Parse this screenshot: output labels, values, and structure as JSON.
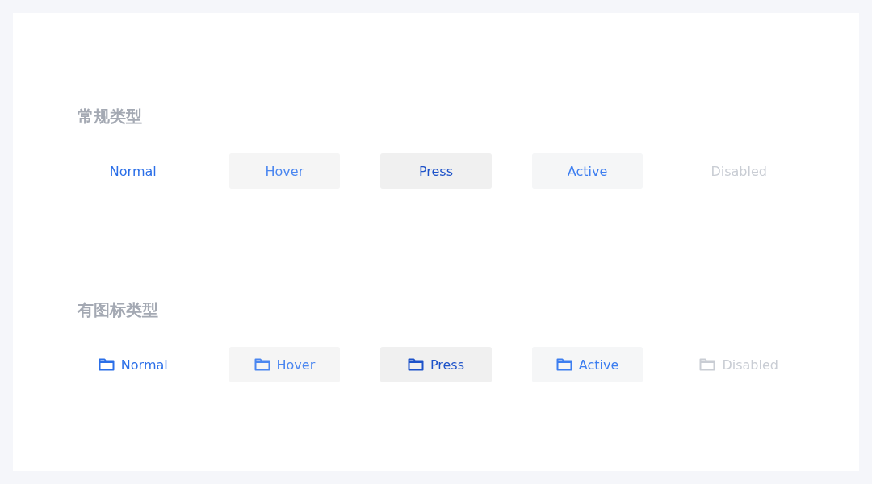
{
  "sections": [
    {
      "title": "常规类型",
      "with_icon": false,
      "buttons": [
        {
          "label": "Normal",
          "kind": "normal"
        },
        {
          "label": "Hover",
          "kind": "hover"
        },
        {
          "label": "Press",
          "kind": "press"
        },
        {
          "label": "Active",
          "kind": "active"
        },
        {
          "label": "Disabled",
          "kind": "disabled"
        }
      ]
    },
    {
      "title": "有图标类型",
      "with_icon": true,
      "buttons": [
        {
          "label": "Normal",
          "kind": "normal"
        },
        {
          "label": "Hover",
          "kind": "hover"
        },
        {
          "label": "Press",
          "kind": "press"
        },
        {
          "label": "Active",
          "kind": "active"
        },
        {
          "label": "Disabled",
          "kind": "disabled"
        }
      ]
    }
  ]
}
